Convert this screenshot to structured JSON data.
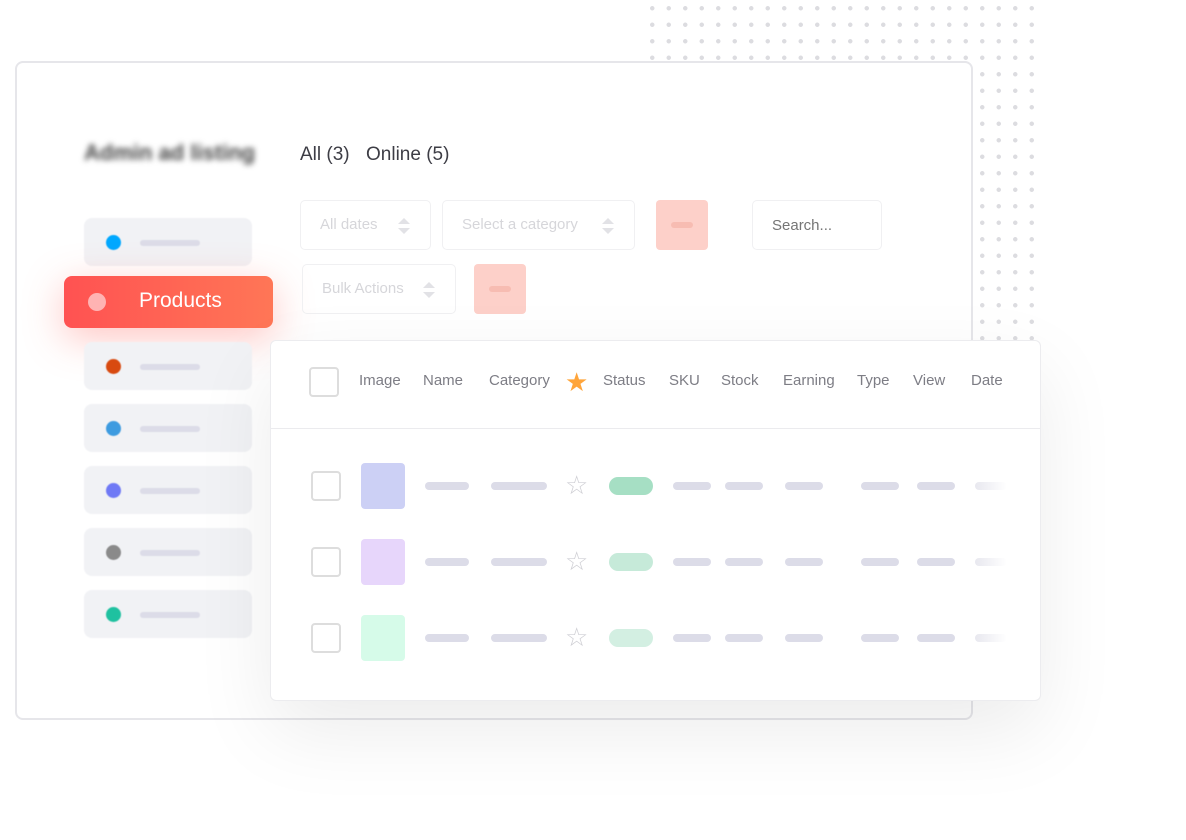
{
  "sidebar": {
    "title": "Admin ad listing",
    "items": [
      {
        "color": "#00a8ff"
      },
      {
        "label": "Products",
        "color": "#ffb3b3",
        "active": true
      },
      {
        "color": "#d84a10"
      },
      {
        "color": "#3d9be0"
      },
      {
        "color": "#6f79f5"
      },
      {
        "color": "#8a8a8a"
      },
      {
        "color": "#1fc1a0"
      }
    ]
  },
  "tabs": [
    {
      "label": "All (3)"
    },
    {
      "label": "Online (5)"
    }
  ],
  "filters": {
    "dates": "All dates",
    "category": "Select a category",
    "search_placeholder": "Search...",
    "bulk": "Bulk Actions"
  },
  "table": {
    "columns": [
      "Image",
      "Name",
      "Category",
      "Status",
      "SKU",
      "Stock",
      "Earning",
      "Type",
      "View",
      "Date"
    ],
    "favorite_icon": "star-icon",
    "rows": [
      {
        "thumb": "#ccd0f5",
        "status_color": "#a6dfc4"
      },
      {
        "thumb": "#e7d6fb",
        "status_color": "#c6ead9"
      },
      {
        "thumb": "#d6fbe9",
        "status_color": "#d3efe2"
      }
    ]
  }
}
